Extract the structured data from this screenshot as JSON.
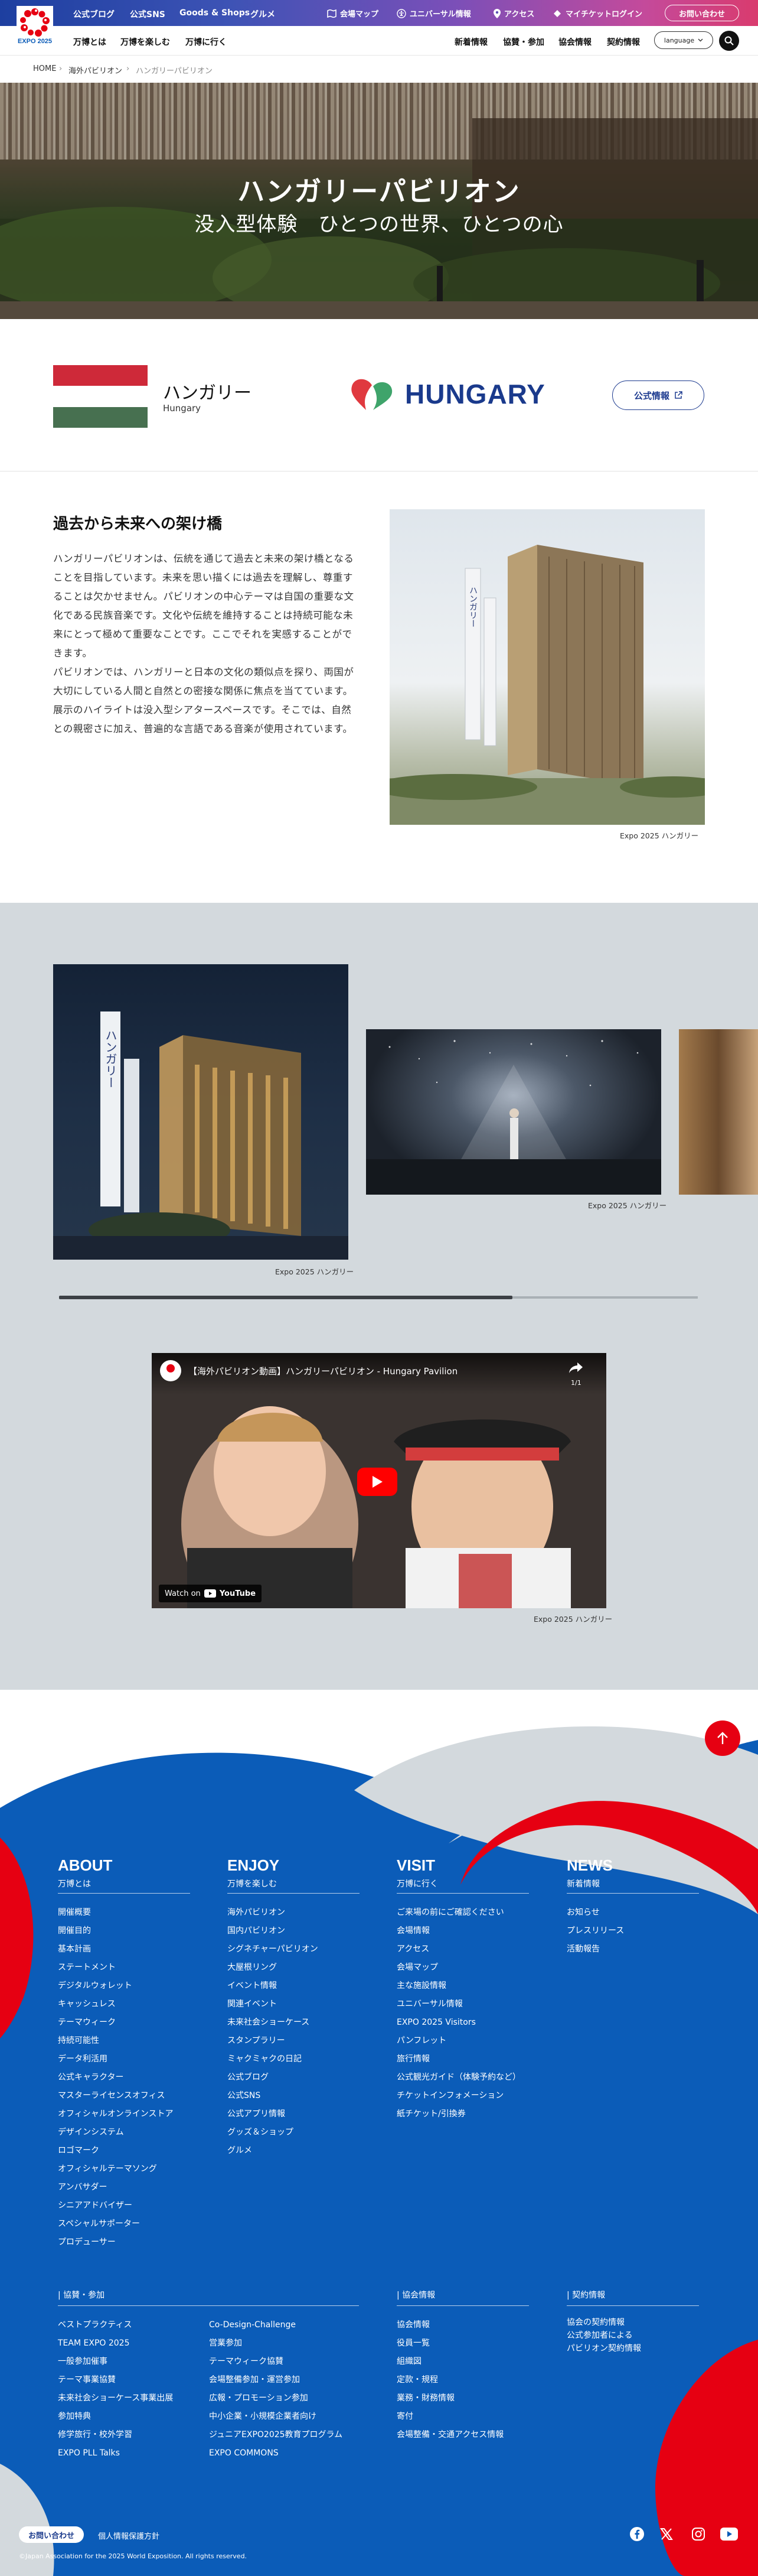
{
  "topbar": {
    "logo_text": "EXPO 2025",
    "links": [
      "公式ブログ",
      "公式SNS",
      "Goods & Shops",
      "グルメ"
    ],
    "right_links": [
      "会場マップ",
      "ユニバーサル情報",
      "アクセス",
      "マイチケットログイン"
    ],
    "inquiry": "お問い合わせ"
  },
  "nav": {
    "left": [
      "万博とは",
      "万博を楽しむ",
      "万博に行く"
    ],
    "right": [
      "新着情報",
      "協賛・参加",
      "協会情報",
      "契約情報"
    ],
    "language": "language"
  },
  "breadcrumb": [
    "HOME",
    "海外パビリオン",
    "ハンガリーパビリオン"
  ],
  "hero": {
    "title": "ハンガリーパビリオン",
    "subtitle": "没入型体験　ひとつの世界、ひとつの心"
  },
  "pavilion": {
    "name": "ハンガリー",
    "name_en": "Hungary",
    "logo_text": "HUNGARY",
    "official_button": "公式情報",
    "flag_colors": [
      "#CE2939",
      "#FFFFFF",
      "#477050"
    ]
  },
  "about": {
    "title": "過去から未来への架け橋",
    "paragraphs": [
      "ハンガリーパビリオンは、伝統を通じて過去と未来の架け橋となることを目指しています。未来を思い描くには過去を理解し、尊重することは欠かせません。パビリオンの中心テーマは自国の重要な文化である民族音楽です。文化や伝統を維持することは持続可能な未来にとって極めて重要なことです。ここでそれを実感することができます。",
      "パビリオンでは、ハンガリーと日本の文化の類似点を探り、両国が大切にしている人間と自然との密接な関係に焦点を当てています。",
      "展示のハイライトは没入型シアタースペースです。そこでは、自然との親密さに加え、普遍的な言語である音楽が使用されています。"
    ],
    "image_caption": "Expo 2025 ハンガリー",
    "image_label": "ハンガリー"
  },
  "gallery": {
    "captions": [
      "Expo 2025 ハンガリー",
      "Expo 2025 ハンガリー"
    ],
    "image_label": "ハンガリー",
    "scroll_progress": 0.71
  },
  "video": {
    "title": "【海外パビリオン動画】ハンガリーパビリオン - Hungary Pavilion",
    "counter": "1/1",
    "watch_on": "Watch on",
    "youtube": "YouTube",
    "caption": "Expo 2025 ハンガリー",
    "share": "共有"
  },
  "footer": {
    "columns": [
      {
        "head": "ABOUT",
        "sub": "万博とは",
        "links": [
          "開催概要",
          "開催目的",
          "基本計画",
          "ステートメント",
          "デジタルウォレット",
          "キャッシュレス",
          "テーマウィーク",
          "持続可能性",
          "データ利活用",
          "公式キャラクター",
          "マスターライセンスオフィス",
          "オフィシャルオンラインストア",
          "デザインシステム",
          "ロゴマーク",
          "オフィシャルテーマソング",
          "アンバサダー",
          "シニアアドバイザー",
          "スペシャルサポーター",
          "プロデューサー"
        ]
      },
      {
        "head": "ENJOY",
        "sub": "万博を楽しむ",
        "links": [
          "海外パビリオン",
          "国内パビリオン",
          "シグネチャーパビリオン",
          "大屋根リング",
          "イベント情報",
          "関連イベント",
          "未来社会ショーケース",
          "スタンプラリー",
          "ミャクミャクの日記",
          "公式ブログ",
          "公式SNS",
          "公式アプリ情報",
          "グッズ＆ショップ",
          "グルメ"
        ]
      },
      {
        "head": "VISIT",
        "sub": "万博に行く",
        "links": [
          "ご来場の前にご確認ください",
          "会場情報",
          "アクセス",
          "会場マップ",
          "主な施設情報",
          "ユニバーサル情報",
          "EXPO 2025 Visitors",
          "パンフレット",
          "旅行情報",
          "公式観光ガイド（体験予約など）",
          "チケットインフォメーション",
          "紙チケット/引換券"
        ]
      },
      {
        "head": "NEWS",
        "sub": "新着情報",
        "links": [
          "お知らせ",
          "プレスリリース",
          "活動報告"
        ]
      }
    ],
    "sponsor": {
      "head": "協賛・参加",
      "links_a": [
        "ベストプラクティス",
        "TEAM EXPO 2025",
        "一般参加催事",
        "テーマ事業協賛",
        "未来社会ショーケース事業出展",
        "参加特典",
        "修学旅行・校外学習",
        "EXPO PLL Talks"
      ],
      "links_b": [
        "Co-Design-Challenge",
        "営業参加",
        "テーマウィーク協賛",
        "会場整備参加・運営参加",
        "広報・プロモーション参加",
        "中小企業・小規模企業者向け",
        "ジュニアEXPO2025教育プログラム",
        "EXPO COMMONS"
      ]
    },
    "assoc": {
      "head": "協会情報",
      "links": [
        "協会情報",
        "役員一覧",
        "組織図",
        "定款・規程",
        "業務・財務情報",
        "寄付",
        "会場整備・交通アクセス情報"
      ]
    },
    "contract": {
      "head": "契約情報",
      "links": [
        "協会の契約情報",
        "公式参加者による\nパビリオン契約情報"
      ]
    },
    "inquiry": "お問い合わせ",
    "privacy": "個人情報保護方針",
    "copyright": "©Japan Association for the 2025 World Exposition. All rights reserved.",
    "social": [
      "facebook-icon",
      "x-icon",
      "instagram-icon",
      "youtube-icon"
    ]
  },
  "colors": {
    "brand_blue": "#0b5cb8",
    "brand_red": "#e60012",
    "navy": "#1c3a8f"
  }
}
